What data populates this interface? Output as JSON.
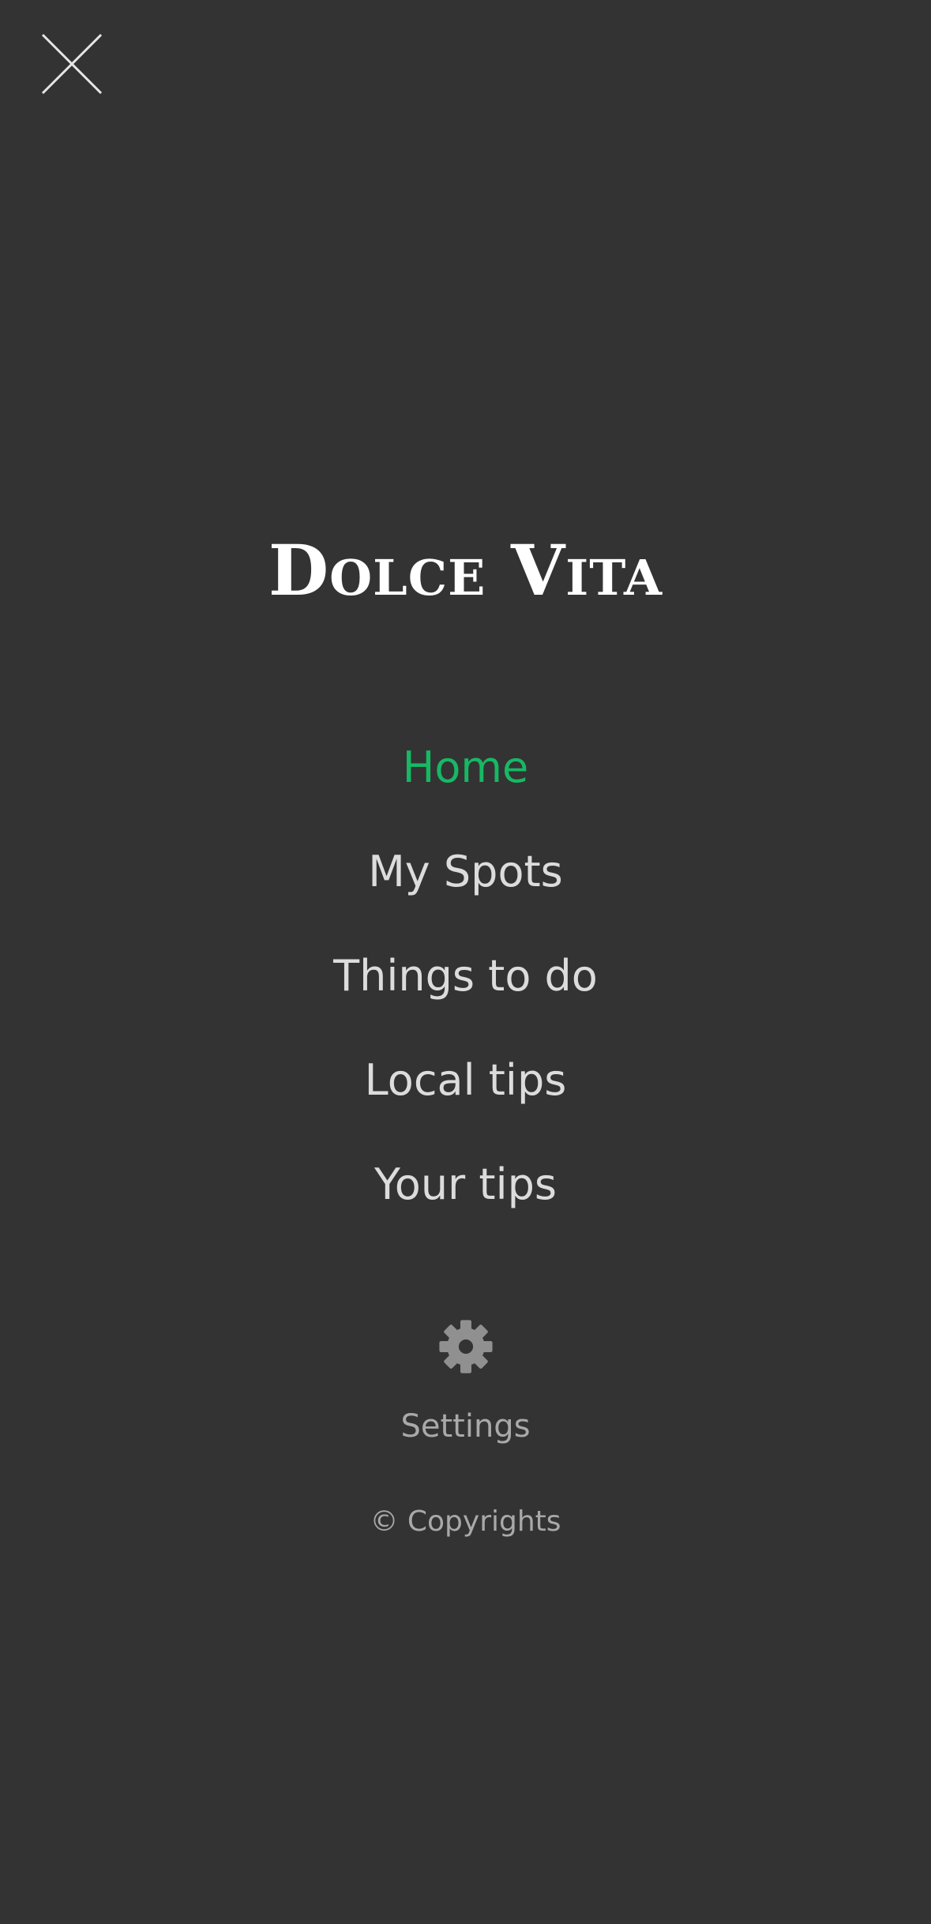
{
  "header": {
    "close_icon": "close-icon"
  },
  "brand": {
    "title": "Dolce Vita"
  },
  "nav": {
    "items": [
      {
        "label": "Home",
        "active": true
      },
      {
        "label": "My Spots",
        "active": false
      },
      {
        "label": "Things to do",
        "active": false
      },
      {
        "label": "Local tips",
        "active": false
      },
      {
        "label": "Your tips",
        "active": false
      }
    ]
  },
  "settings": {
    "icon": "gear-icon",
    "label": "Settings"
  },
  "footer": {
    "copyright": "© Copyrights"
  },
  "colors": {
    "background": "#333333",
    "accent": "#17b864",
    "text": "#dcdcdc",
    "muted": "#a9a9a9"
  }
}
